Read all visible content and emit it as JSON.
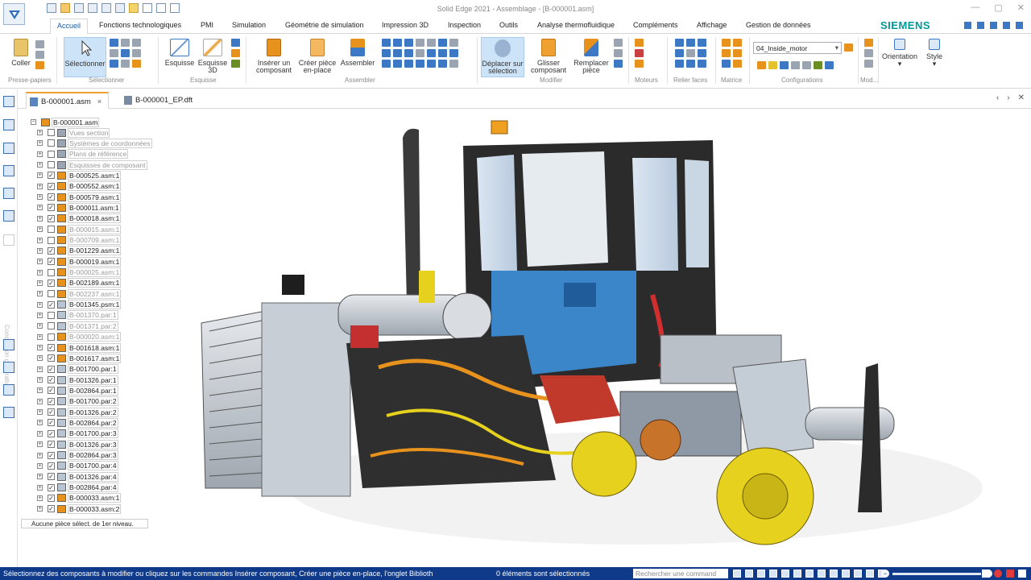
{
  "window": {
    "title": "Solid Edge 2021 - Assemblage - [B-000001.asm]",
    "brand": "SIEMENS"
  },
  "ribbon_tabs": [
    {
      "label": "Accueil",
      "active": true
    },
    {
      "label": "Fonctions technologiques"
    },
    {
      "label": "PMI"
    },
    {
      "label": "Simulation"
    },
    {
      "label": "Géométrie de simulation"
    },
    {
      "label": "Impression 3D"
    },
    {
      "label": "Inspection"
    },
    {
      "label": "Outils"
    },
    {
      "label": "Analyse thermofluidique"
    },
    {
      "label": "Compléments"
    },
    {
      "label": "Affichage"
    },
    {
      "label": "Gestion de données"
    }
  ],
  "ribbon": {
    "coller": "Coller",
    "selectionner": "Sélectionner",
    "esquisse": "Esquisse",
    "esquisse3d_1": "Esquisse",
    "esquisse3d_2": "3D",
    "inserer_1": "Insérer un",
    "inserer_2": "composant",
    "creer_1": "Créer pièce",
    "creer_2": "en-place",
    "assembler": "Assembler",
    "deplacer_1": "Déplacer sur",
    "deplacer_2": "sélection",
    "glisser_1": "Glisser",
    "glisser_2": "composant",
    "remplacer_1": "Remplacer",
    "remplacer_2": "pièce",
    "orientation": "Orientation",
    "style": "Style",
    "config_value": "04_Inside_motor",
    "groups": {
      "presse_papiers": "Presse-papiers",
      "selectionner": "Sélectionner",
      "esquisse": "Esquisse",
      "assembler": "Assembler",
      "modifier": "Modifier",
      "moteurs": "Moteurs",
      "relier_faces": "Relier faces",
      "matrice": "Matrice",
      "configurations": "Configurations",
      "mod": "Mod..."
    }
  },
  "doc_tabs": [
    {
      "label": "B-000001.asm",
      "close": "×",
      "active": true
    },
    {
      "label": "B-000001_EP.dft"
    }
  ],
  "rail_label": "Conception générative",
  "tree": {
    "root": "B-000001.asm",
    "items": [
      {
        "label": "Vues section",
        "checked": false,
        "grey": true
      },
      {
        "label": "Systèmes de coordonnées",
        "checked": false,
        "grey": true
      },
      {
        "label": "Plans de référence",
        "checked": false,
        "grey": true
      },
      {
        "label": "Esquisses de composant",
        "checked": false,
        "grey": true
      },
      {
        "label": "B-000525.asm:1",
        "checked": true
      },
      {
        "label": "B-000552.asm:1",
        "checked": true
      },
      {
        "label": "B-000579.asm:1",
        "checked": true
      },
      {
        "label": "B-000011.asm:1",
        "checked": true
      },
      {
        "label": "B-000018.asm:1",
        "checked": true
      },
      {
        "label": "B-000015.asm:1",
        "checked": false,
        "grey": true
      },
      {
        "label": "B-000709.asm:1",
        "checked": false,
        "grey": true
      },
      {
        "label": "B-001229.asm:1",
        "checked": true
      },
      {
        "label": "B-000019.asm:1",
        "checked": true
      },
      {
        "label": "B-000025.asm:1",
        "checked": false,
        "grey": true
      },
      {
        "label": "B-002189.asm:1",
        "checked": true
      },
      {
        "label": "B-002237.asm:1",
        "checked": false,
        "grey": true
      },
      {
        "label": "B-001345.psm:1",
        "checked": true
      },
      {
        "label": "B-001370.par:1",
        "checked": false,
        "grey": true
      },
      {
        "label": "B-001371.par:2",
        "checked": false,
        "grey": true
      },
      {
        "label": "B-000020.asm:1",
        "checked": false,
        "grey": true
      },
      {
        "label": "B-001618.asm:1",
        "checked": true
      },
      {
        "label": "B-001617.asm:1",
        "checked": true
      },
      {
        "label": "B-001700.par:1",
        "checked": true
      },
      {
        "label": "B-001326.par:1",
        "checked": true
      },
      {
        "label": "B-002864.par:1",
        "checked": true
      },
      {
        "label": "B-001700.par:2",
        "checked": true
      },
      {
        "label": "B-001326.par:2",
        "checked": true
      },
      {
        "label": "B-002864.par:2",
        "checked": true
      },
      {
        "label": "B-001700.par:3",
        "checked": true
      },
      {
        "label": "B-001326.par:3",
        "checked": true
      },
      {
        "label": "B-002864.par:3",
        "checked": true
      },
      {
        "label": "B-001700.par:4",
        "checked": true
      },
      {
        "label": "B-001326.par:4",
        "checked": true
      },
      {
        "label": "B-002864.par:4",
        "checked": true
      },
      {
        "label": "B-000033.asm:1",
        "checked": true
      },
      {
        "label": "B-000033.asm:2",
        "checked": true
      }
    ],
    "status": "Aucune pièce sélect. de 1er niveau."
  },
  "statusbar": {
    "message": "Sélectionnez des composants à modifier ou cliquez sur les commandes Insérer composant, Créer une pièce en-place, l'onglet Biblioth",
    "count": "0 éléments sont sélectionnés",
    "search_placeholder": "Rechercher une command"
  },
  "colors": {
    "accent": "#1a5ca8",
    "statusbar": "#0f3a8a",
    "brand": "#009999",
    "cab_frame": "#2b2b2b",
    "yellow_parts": "#e6d21e",
    "blue_parts": "#3a86c8"
  }
}
